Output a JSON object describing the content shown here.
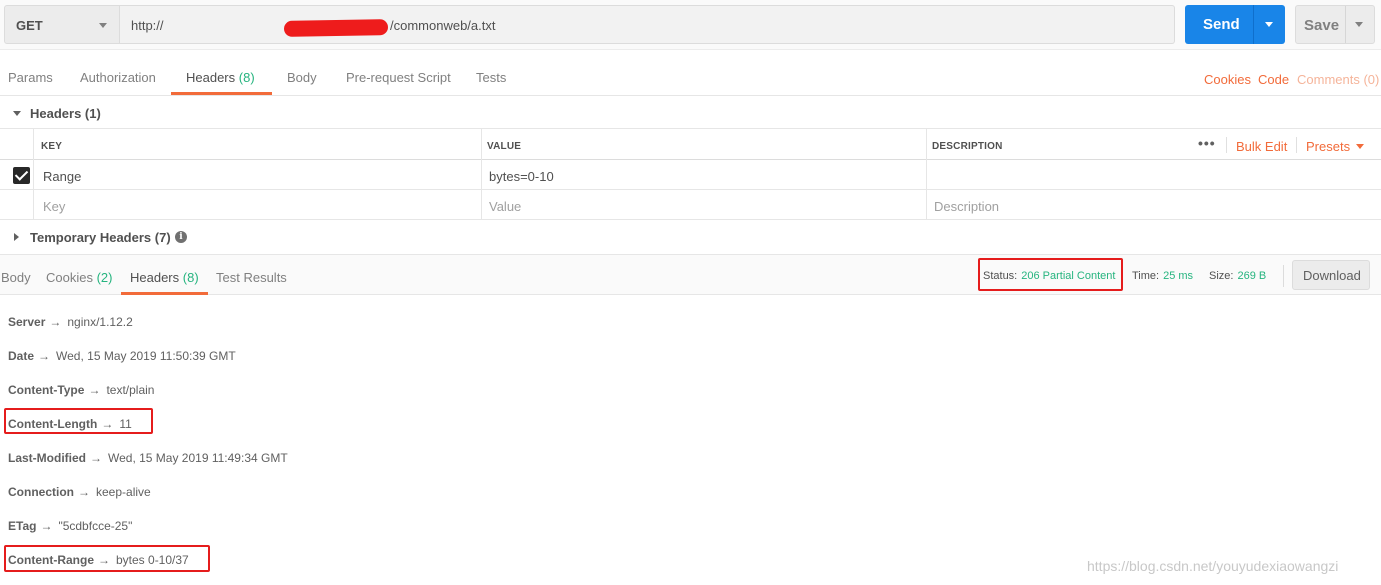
{
  "request": {
    "method": "GET",
    "url_prefix": "http://",
    "url_suffix": "/commonweb/a.txt",
    "send_label": "Send",
    "save_label": "Save"
  },
  "request_tabs": {
    "items": [
      {
        "label": "Params",
        "count": ""
      },
      {
        "label": "Authorization",
        "count": ""
      },
      {
        "label": "Headers",
        "count": "(8)"
      },
      {
        "label": "Body",
        "count": ""
      },
      {
        "label": "Pre-request Script",
        "count": ""
      },
      {
        "label": "Tests",
        "count": ""
      }
    ],
    "active": "Headers",
    "right_links": [
      "Cookies",
      "Code",
      "Comments (0)"
    ]
  },
  "headers_section": {
    "title": "Headers (1)",
    "columns": [
      "KEY",
      "VALUE",
      "DESCRIPTION"
    ],
    "bulk_edit": "Bulk Edit",
    "presets": "Presets",
    "rows": [
      {
        "checked": true,
        "key": "Range",
        "value": "bytes=0-10",
        "description": ""
      }
    ],
    "placeholder": {
      "key": "Key",
      "value": "Value",
      "description": "Description"
    },
    "temporary_title": "Temporary Headers (7)"
  },
  "response": {
    "tabs": [
      {
        "label": "Body",
        "count": ""
      },
      {
        "label": "Cookies",
        "count": "(2)"
      },
      {
        "label": "Headers",
        "count": "(8)"
      },
      {
        "label": "Test Results",
        "count": ""
      }
    ],
    "active": "Headers",
    "status_label": "Status:",
    "status_value": "206 Partial Content",
    "time_label": "Time:",
    "time_value": "25 ms",
    "size_label": "Size:",
    "size_value": "269 B",
    "download_label": "Download",
    "accent_color": "#26b47f",
    "headers": [
      {
        "key": "Server",
        "value": "nginx/1.12.2"
      },
      {
        "key": "Date",
        "value": "Wed, 15 May 2019 11:50:39 GMT"
      },
      {
        "key": "Content-Type",
        "value": "text/plain"
      },
      {
        "key": "Content-Length",
        "value": "11"
      },
      {
        "key": "Last-Modified",
        "value": "Wed, 15 May 2019 11:49:34 GMT"
      },
      {
        "key": "Connection",
        "value": "keep-alive"
      },
      {
        "key": "ETag",
        "value": "\"5cdbfcce-25\""
      },
      {
        "key": "Content-Range",
        "value": "bytes 0-10/37"
      }
    ],
    "arrow": "→"
  },
  "watermark": "https://blog.csdn.net/youyudexiaowangzi",
  "colors": {
    "brand_orange": "#f26b3a",
    "send_blue": "#1985e8",
    "highlight_red": "#e51c1c"
  }
}
